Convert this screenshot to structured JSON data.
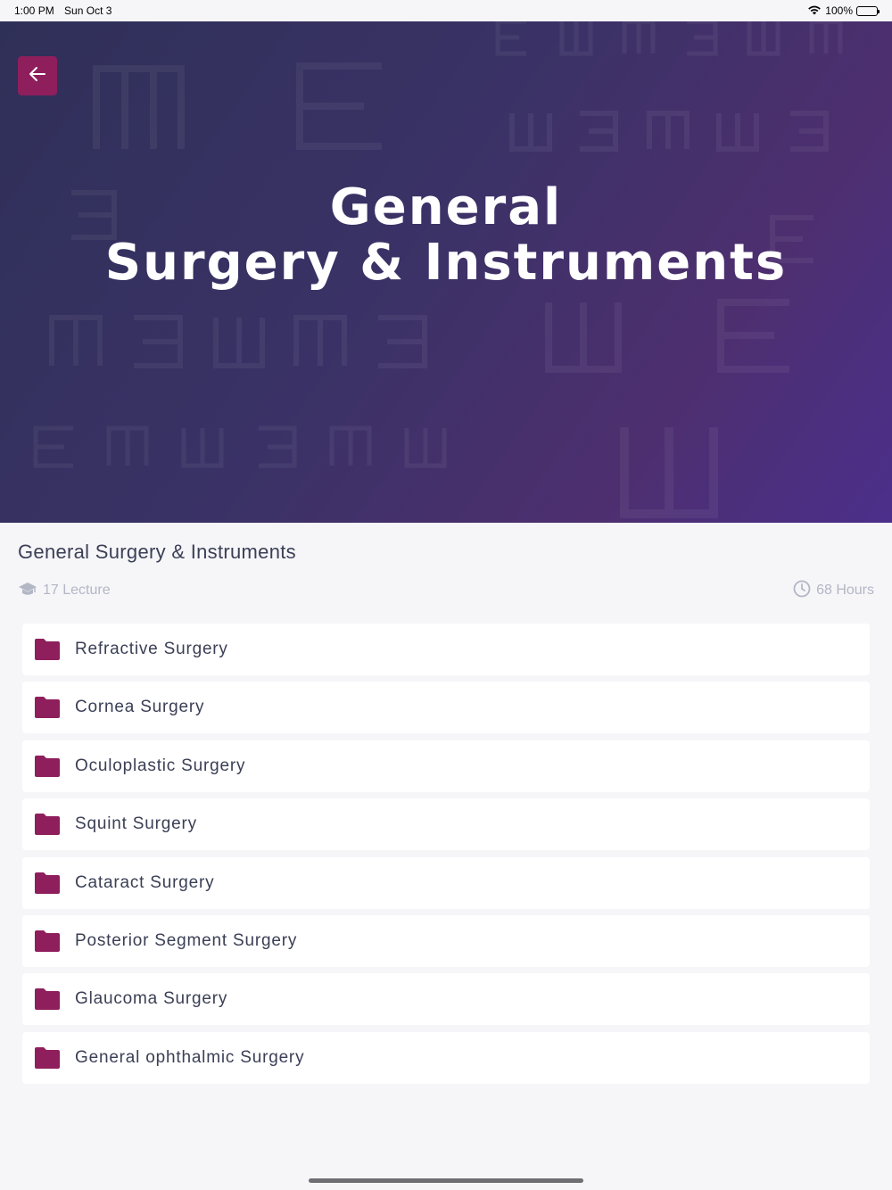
{
  "status_bar": {
    "time": "1:00 PM",
    "date": "Sun Oct 3",
    "battery": "100%",
    "wifi_icon": "wifi-icon",
    "battery_icon": "battery-icon"
  },
  "hero": {
    "title_line1": "General",
    "title_line2": "Surgery & Instruments",
    "back_icon": "arrow-left-icon"
  },
  "course": {
    "title": "General Surgery & Instruments",
    "lectures": "17 Lecture",
    "hours": "68 Hours",
    "lecture_icon": "graduation-cap-icon",
    "hours_icon": "clock-icon"
  },
  "folders": [
    {
      "label": "Refractive Surgery"
    },
    {
      "label": "Cornea Surgery"
    },
    {
      "label": "Oculoplastic Surgery"
    },
    {
      "label": "Squint Surgery"
    },
    {
      "label": "Cataract Surgery"
    },
    {
      "label": "Posterior Segment Surgery"
    },
    {
      "label": "Glaucoma Surgery"
    },
    {
      "label": "General ophthalmic Surgery"
    }
  ],
  "colors": {
    "accent": "#8e1f5c",
    "hero_start": "#2f3058",
    "hero_end": "#4b2f8a",
    "background": "#f6f6f9"
  }
}
